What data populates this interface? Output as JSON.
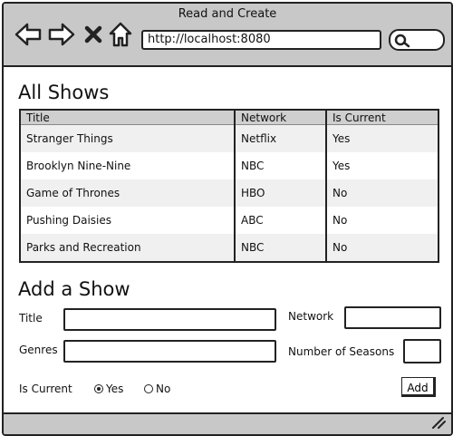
{
  "window": {
    "title": "Read and Create"
  },
  "browser": {
    "url": "http://localhost:8080"
  },
  "shows": {
    "heading": "All Shows",
    "columns": [
      "Title",
      "Network",
      "Is Current"
    ],
    "rows": [
      [
        "Stranger Things",
        "Netflix",
        "Yes"
      ],
      [
        "Brooklyn Nine-Nine",
        "NBC",
        "Yes"
      ],
      [
        "Game of Thrones",
        "HBO",
        "No"
      ],
      [
        "Pushing Daisies",
        "ABC",
        "No"
      ],
      [
        "Parks and Recreation",
        "NBC",
        "No"
      ]
    ]
  },
  "form": {
    "heading": "Add a Show",
    "title_label": "Title",
    "network_label": "Network",
    "genres_label": "Genres",
    "seasons_label": "Number of Seasons",
    "is_current_label": "Is Current",
    "yes_label": "Yes",
    "no_label": "No",
    "is_current_selected": "Yes",
    "add_label": "Add"
  }
}
